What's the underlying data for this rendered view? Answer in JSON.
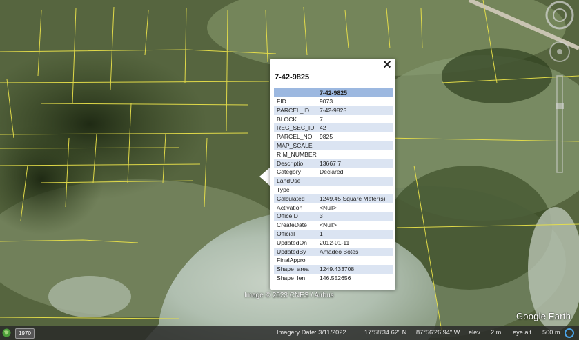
{
  "popup": {
    "title": "7-42-9825",
    "header": "7-42-9825",
    "close_label": "✕",
    "rows": [
      {
        "key": "FID",
        "value": "9073"
      },
      {
        "key": "PARCEL_ID",
        "value": "7-42-9825"
      },
      {
        "key": "BLOCK",
        "value": "7"
      },
      {
        "key": "REG_SEC_ID",
        "value": "42"
      },
      {
        "key": "PARCEL_NO",
        "value": "9825"
      },
      {
        "key": "MAP_SCALE",
        "value": ""
      },
      {
        "key": "RIM_NUMBER",
        "value": ""
      },
      {
        "key": "Descriptio",
        "value": "13667 7"
      },
      {
        "key": "Category",
        "value": "Declared"
      },
      {
        "key": "LandUse",
        "value": ""
      },
      {
        "key": "Type",
        "value": ""
      },
      {
        "key": "Calculated",
        "value": "1249.45 Square Meter(s)"
      },
      {
        "key": "Activation",
        "value": "<Null>"
      },
      {
        "key": "OfficeID",
        "value": "3"
      },
      {
        "key": "CreateDate",
        "value": "<Null>"
      },
      {
        "key": "Official",
        "value": "1"
      },
      {
        "key": "UpdatedOn",
        "value": "2012-01-11"
      },
      {
        "key": "UpdatedBy",
        "value": "Amadeo Botes"
      },
      {
        "key": "FinalAppro",
        "value": ""
      },
      {
        "key": "Shape_area",
        "value": "1249.433708"
      },
      {
        "key": "Shape_len",
        "value": "146.552656"
      }
    ]
  },
  "map": {
    "credit": "Image © 2023 CNES / Airbus",
    "brand": "Google Earth"
  },
  "status_bar": {
    "year": "1970",
    "imagery_date": "Imagery Date: 3/11/2022",
    "latitude": "17°58'34.62\" N",
    "longitude": "87°56'26.94\" W",
    "elev_label": "elev",
    "elev_value": "2 m",
    "eye_alt_label": "eye alt",
    "eye_alt_value": "500 m"
  },
  "colors": {
    "parcel_lines": "#e8e04a",
    "table_header": "#9cb8e0",
    "table_alt_row": "#dbe4f2"
  }
}
